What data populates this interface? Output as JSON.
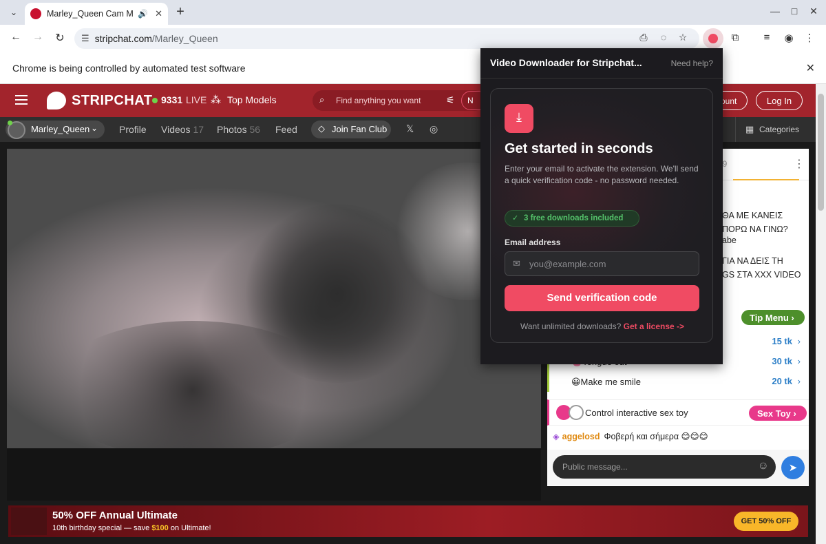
{
  "browser": {
    "tab_title": "Marley_Queen Cam M",
    "tab_audio_icon": "speaker-icon",
    "url_host": "stripchat.com",
    "url_path": "/Marley_Queen",
    "infobar_message": "Chrome is being controlled by automated test software"
  },
  "site": {
    "logo_text": "STRIPCHAT",
    "live_count": "9331",
    "live_label": "LIVE",
    "top_models_label": "Top Models",
    "search_placeholder": "Find anything you want",
    "search_button_label": "N",
    "account_button_label": "ount",
    "login_label": "Log In",
    "accent_color": "#a2242c"
  },
  "subnav": {
    "model_name": "Marley_Queen",
    "profile_label": "Profile",
    "videos_label": "Videos",
    "videos_count": "17",
    "photos_label": "Photos",
    "photos_count": "56",
    "feed_label": "Feed",
    "fanclub_label": "Join Fan Club",
    "categories_label": "Categories"
  },
  "chat": {
    "header_count": "39",
    "messages": [
      "ΘΑ ΜΕ ΚΑΝΕΙΣ",
      "ΠΟΡΩ ΝΑ ΓΙΝΩ?",
      "abe",
      "ΓΙΑ ΝΑ ΔΕΙΣ ΤΗ",
      "GS ΣΤΑ XXX VIDEO"
    ],
    "tip_menu_label": "Tip Menu",
    "tip_items": [
      {
        "label": "",
        "price": "15 tk"
      },
      {
        "label": "👅Tongue out",
        "price": "30 tk"
      },
      {
        "label": "😀Make me smile",
        "price": "20 tk"
      }
    ],
    "toy_label": "Control interactive sex toy",
    "toy_button_label": "Sex Toy",
    "user_message_name": "aggelosd",
    "user_message_text": "Φοβερή και σήμερα 😊😊😊",
    "input_placeholder": "Public message..."
  },
  "promo": {
    "title": "50% OFF Annual Ultimate",
    "subtitle_pre": "10th birthday special — save ",
    "subtitle_amount": "$100",
    "subtitle_post": " on Ultimate!",
    "button_label": "GET 50% OFF"
  },
  "extension_popup": {
    "title": "Video Downloader for Stripchat...",
    "help_label": "Need help?",
    "card_title": "Get started in seconds",
    "card_desc": "Enter your email to activate the extension. We'll send a quick verification code - no password needed.",
    "badge_label": "3 free downloads included",
    "email_label": "Email address",
    "email_placeholder": "you@example.com",
    "submit_label": "Send verification code",
    "license_prompt": "Want unlimited downloads?",
    "license_link": "Get a license ->",
    "accent_color": "#f04b63"
  }
}
